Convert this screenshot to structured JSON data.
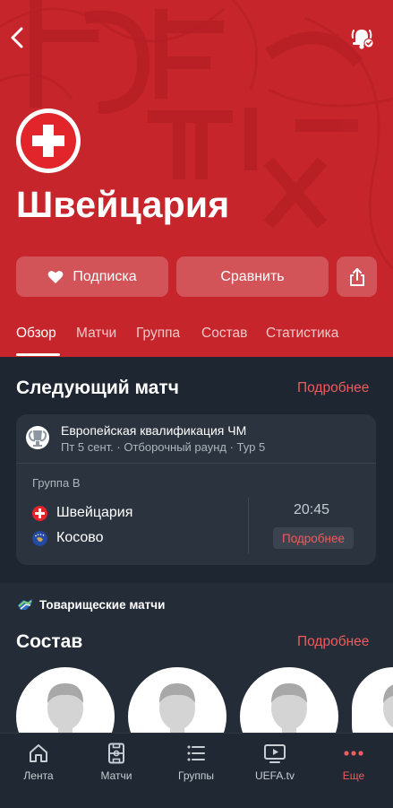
{
  "header": {
    "team_name": "Швейцария",
    "subscribe_label": "Подписка",
    "compare_label": "Сравнить",
    "tabs": [
      {
        "label": "Обзор",
        "active": true
      },
      {
        "label": "Матчи"
      },
      {
        "label": "Группа"
      },
      {
        "label": "Состав"
      },
      {
        "label": "Статистика"
      }
    ]
  },
  "next_match": {
    "title": "Следующий матч",
    "more_label": "Подробнее",
    "competition": "Европейская квалификация ЧМ",
    "info": "Пт 5 сент. · Отборочный раунд · Тур 5",
    "group": "Группа B",
    "home_team": "Швейцария",
    "away_team": "Косово",
    "kickoff": "20:45",
    "detail_label": "Подробнее"
  },
  "friendly": {
    "label": "Товарищеские матчи"
  },
  "squad": {
    "title": "Состав",
    "more_label": "Подробнее"
  },
  "nav": {
    "items": [
      {
        "label": "Лента",
        "icon": "home-icon"
      },
      {
        "label": "Матчи",
        "icon": "pitch-icon"
      },
      {
        "label": "Группы",
        "icon": "list-icon"
      },
      {
        "label": "UEFA.tv",
        "icon": "tv-icon"
      },
      {
        "label": "Еще",
        "icon": "more-dots-icon",
        "active": true
      }
    ]
  },
  "colors": {
    "header_red": "#c6252b",
    "accent": "#ef5b5f",
    "background": "#1d2631",
    "card": "#2a333e"
  }
}
